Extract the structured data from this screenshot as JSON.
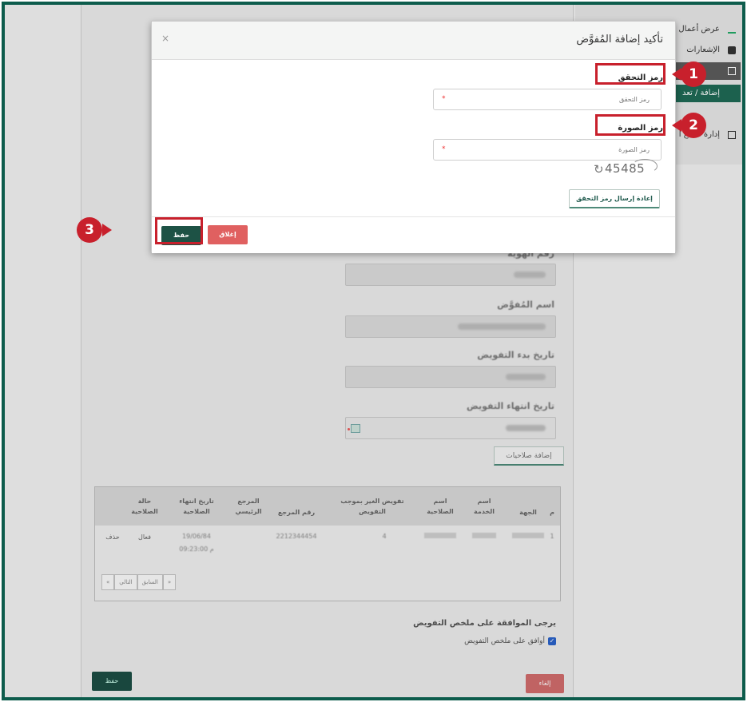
{
  "sidebar": {
    "items": [
      {
        "label": "عرض أعمال"
      },
      {
        "label": "الإشعارات"
      },
      {
        "label": ""
      },
      {
        "label": "إضافة / تعد"
      },
      {
        "label": "إدارة قطاع ا"
      }
    ]
  },
  "form": {
    "labels": [
      "رقم الهوية",
      "اسم المُفوَّض",
      "تاريخ بدء التفويض",
      "تاريخ انتهاء التفويض"
    ],
    "add_permissions": "إضافة صلاحيات"
  },
  "table": {
    "headers": [
      "م",
      "الجهة",
      "اسم الخدمة",
      "اسم الصلاحية",
      "تفويض الغير بموجب التفويض",
      "رقم المرجع",
      "المرجع الرئيسي",
      "تاريخ انتهاء الصلاحية",
      "حالة الصلاحية"
    ],
    "row": {
      "num": "1",
      "status": "فعال",
      "delete": "حذف",
      "count": "4",
      "ref": "2212344454",
      "date1": "19/06/84",
      "date2": "م 09:23:00"
    },
    "pager": {
      "prev": "السابق",
      "next": "التالي",
      "first": "»",
      "last": "«"
    }
  },
  "agreement": {
    "title": "يرجى الموافقة على ملخص التفويض",
    "checkbox_label": "أوافق على ملخص التفويض"
  },
  "page_buttons": {
    "save": "حفظ",
    "cancel": "إلغاء"
  },
  "modal": {
    "title": "تأكيد إضافة المُفوَّض",
    "close_icon": "×",
    "verification_label": "رمز التحقق",
    "verification_placeholder": "رمز التحقق",
    "image_label": "رمز الصورة",
    "image_placeholder": "رمز الصورة",
    "captcha_text": "45485",
    "refresh_glyph": "↻",
    "resend_button": "إعادة إرسال رمز التحقق",
    "save_button": "حفظ",
    "close_button": "إغلاق",
    "required_mark": "*"
  },
  "annotations": {
    "marker_1": "1",
    "marker_2": "2",
    "marker_3": "3",
    "color": "#c8202c"
  },
  "colors": {
    "brand": "#0d5c4c",
    "save_button": "#1d5245",
    "close_button": "#e06060"
  }
}
